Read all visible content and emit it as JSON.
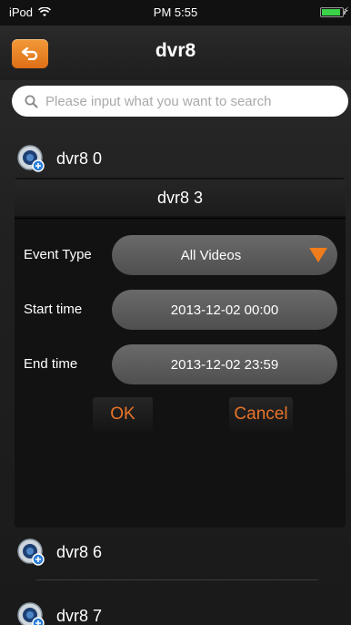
{
  "status_bar": {
    "carrier": "iPod",
    "time": "PM 5:55"
  },
  "nav": {
    "title": "dvr8",
    "back_icon": "back-arrow-icon"
  },
  "search": {
    "placeholder": "Please input what you want to search"
  },
  "devices": [
    {
      "name": "dvr8 0"
    },
    {
      "name": "dvr8 6"
    },
    {
      "name": "dvr8 7"
    }
  ],
  "dialog": {
    "title": "dvr8 3",
    "event_type_label": "Event Type",
    "event_type_value": "All Videos",
    "start_label": "Start time",
    "start_value": "2013-12-02 00:00",
    "end_label": "End time",
    "end_value": "2013-12-02 23:59",
    "ok_label": "OK",
    "cancel_label": "Cancel"
  },
  "colors": {
    "accent": "#e8742a",
    "back_button": "#ee8a2c",
    "battery": "#3bd24a"
  }
}
